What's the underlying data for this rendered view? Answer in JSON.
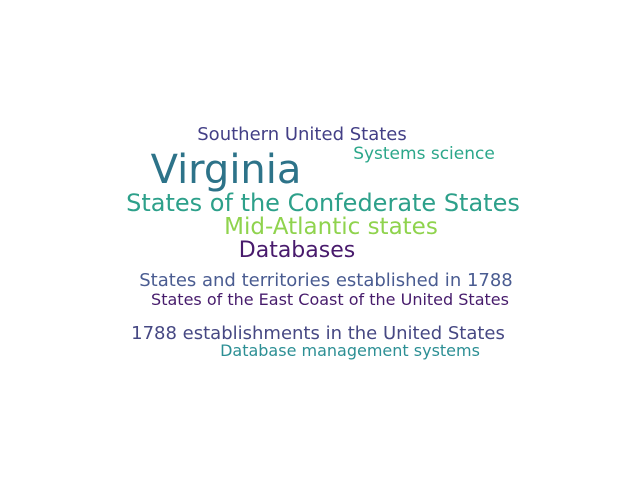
{
  "words": [
    {
      "id": "virginia",
      "text": "Virginia",
      "color": "#2d7389"
    },
    {
      "id": "southern",
      "text": "Southern United States",
      "color": "#433f86"
    },
    {
      "id": "systems",
      "text": "Systems science",
      "color": "#2ba78a"
    },
    {
      "id": "confederate",
      "text": "States of the Confederate States",
      "color": "#2da08a"
    },
    {
      "id": "midatlantic",
      "text": "Mid-Atlantic states",
      "color": "#8fd34d"
    },
    {
      "id": "databases",
      "text": "Databases",
      "color": "#481a6c"
    },
    {
      "id": "territories",
      "text": "States and territories established in 1788",
      "color": "#4a5c91"
    },
    {
      "id": "eastcoast",
      "text": "States of the East Coast of the United States",
      "color": "#471c6c"
    },
    {
      "id": "1788est",
      "text": "1788 establishments in the United States",
      "color": "#464883"
    },
    {
      "id": "dbms",
      "text": "Database management systems",
      "color": "#2c8f94"
    }
  ]
}
